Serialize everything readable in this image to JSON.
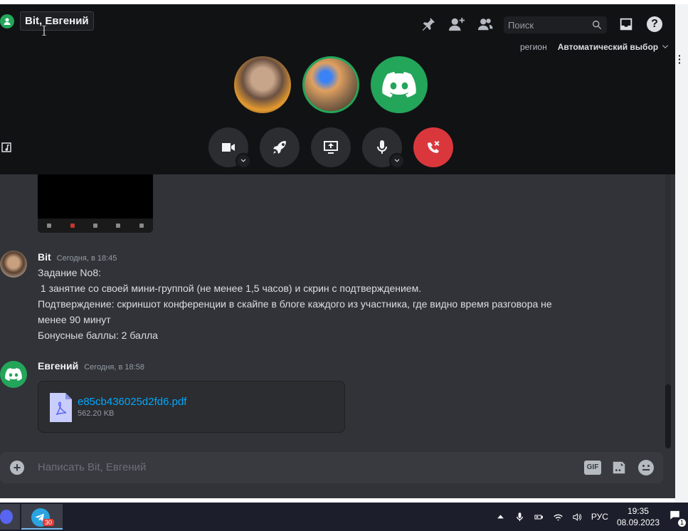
{
  "header": {
    "title": "Bit, Евгений",
    "search_placeholder": "Поиск",
    "region_label": "регион",
    "region_value": "Автоматический выбор"
  },
  "call": {
    "participants": [
      "participant-photo",
      "participant-sunglasses",
      "participant-discord-default"
    ],
    "controls": [
      "camera",
      "activity",
      "screen-share",
      "microphone",
      "disconnect"
    ]
  },
  "messages": [
    {
      "author": "Bit",
      "timestamp": "Сегодня, в 18:45",
      "lines": [
        "Задание No8:",
        " 1 занятие со своей мини-группой (не менее 1,5 часов) и скрин с подтверждением.",
        "Подтверждение: скриншот конференции в скайпе в блоге каждого из участника, где видно время разговора не",
        "менее 90 минут",
        "Бонусные баллы: 2 балла"
      ]
    },
    {
      "author": "Евгений",
      "timestamp": "Сегодня, в 18:58",
      "attachment": {
        "file_name": "e85cb436025d2fd6.pdf",
        "file_size": "562.20 KB"
      }
    }
  ],
  "composer": {
    "placeholder": "Написать Bit, Евгений",
    "gif_label": "GIF"
  },
  "taskbar": {
    "telegram_badge": "30",
    "language": "РУС",
    "time": "19:35",
    "date": "08.09.2023",
    "notifications": "1"
  },
  "colors": {
    "call_bg": "#111214",
    "chat_bg": "#313338",
    "online_green": "#23a55a",
    "hangup_red": "#da373c",
    "link_blue": "#00a8fc"
  }
}
